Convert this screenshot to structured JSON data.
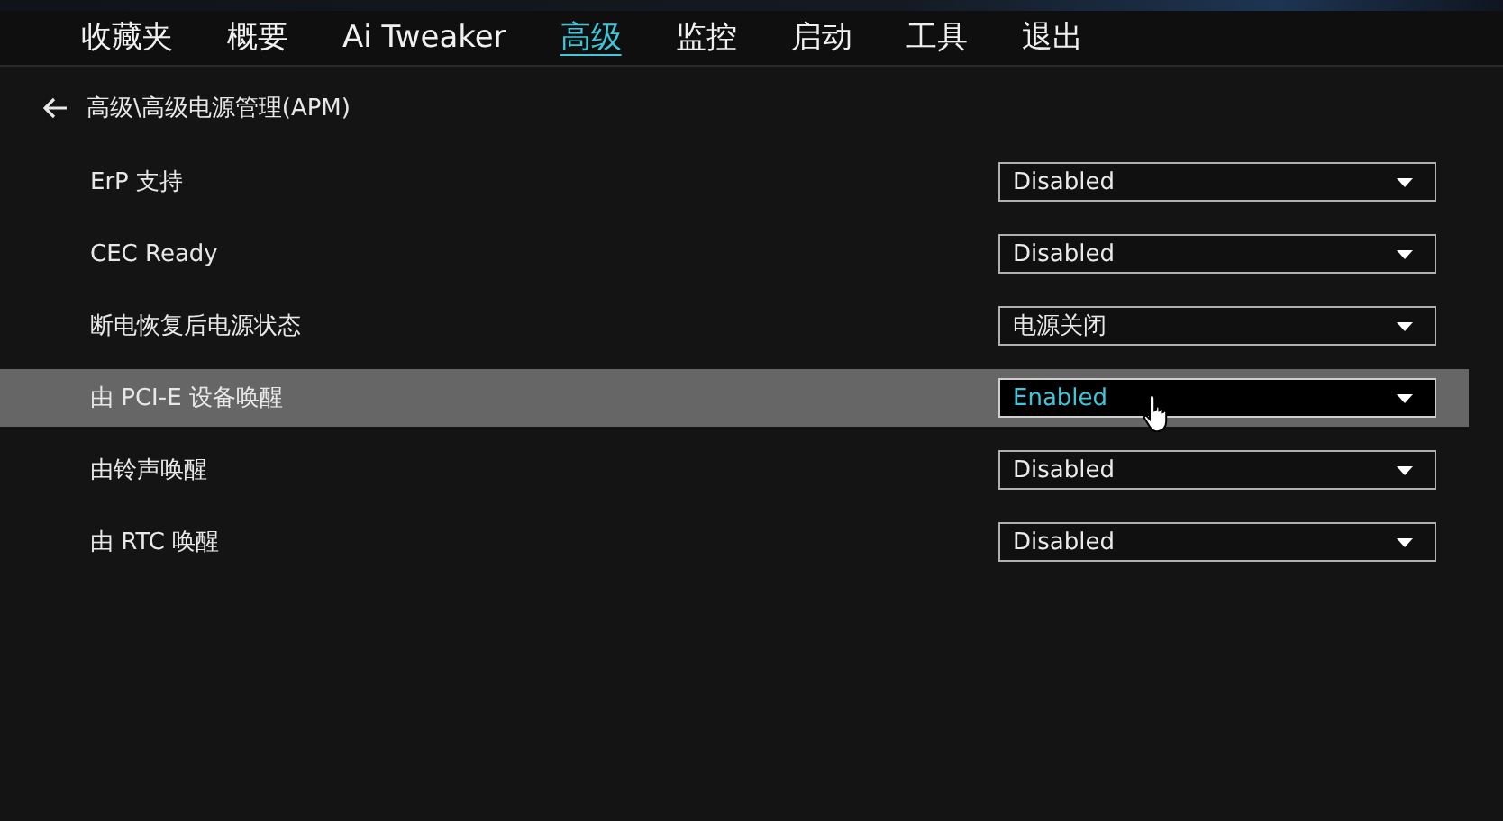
{
  "tabs": [
    {
      "label": "收藏夹",
      "selected": false
    },
    {
      "label": "概要",
      "selected": false
    },
    {
      "label": "Ai Tweaker",
      "selected": false
    },
    {
      "label": "高级",
      "selected": true
    },
    {
      "label": "监控",
      "selected": false
    },
    {
      "label": "启动",
      "selected": false
    },
    {
      "label": "工具",
      "selected": false
    },
    {
      "label": "退出",
      "selected": false
    }
  ],
  "breadcrumb": "高级\\高级电源管理(APM)",
  "settings": [
    {
      "label": "ErP 支持",
      "value": "Disabled",
      "selected": false
    },
    {
      "label": "CEC Ready",
      "value": "Disabled",
      "selected": false
    },
    {
      "label": "断电恢复后电源状态",
      "value": "电源关闭",
      "selected": false
    },
    {
      "label": "由 PCI-E 设备唤醒",
      "value": "Enabled",
      "selected": true
    },
    {
      "label": "由铃声唤醒",
      "value": "Disabled",
      "selected": false
    },
    {
      "label": "由 RTC 唤醒",
      "value": "Disabled",
      "selected": false
    }
  ]
}
